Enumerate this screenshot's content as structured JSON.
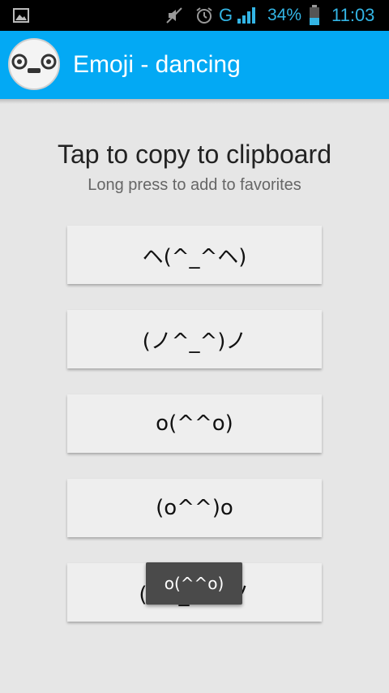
{
  "status_bar": {
    "network": "G",
    "battery_percent": "34%",
    "time": "11:03",
    "icons": [
      "gallery-icon",
      "mute-icon",
      "alarm-icon",
      "signal-icon",
      "battery-icon"
    ]
  },
  "action_bar": {
    "title": "Emoji - dancing",
    "app_icon": "emoji-face-icon",
    "background": "#03a9f4"
  },
  "main": {
    "heading": "Tap to copy to clipboard",
    "subheading": "Long press to add to favorites",
    "emojis": [
      "ヘ(^_^ヘ)",
      "(ノ^_^)ノ",
      "o(^^o)",
      "(o^^)o",
      "(ノ´_ゝ`)ノ"
    ]
  },
  "toast": {
    "text": "o(^^o)"
  }
}
